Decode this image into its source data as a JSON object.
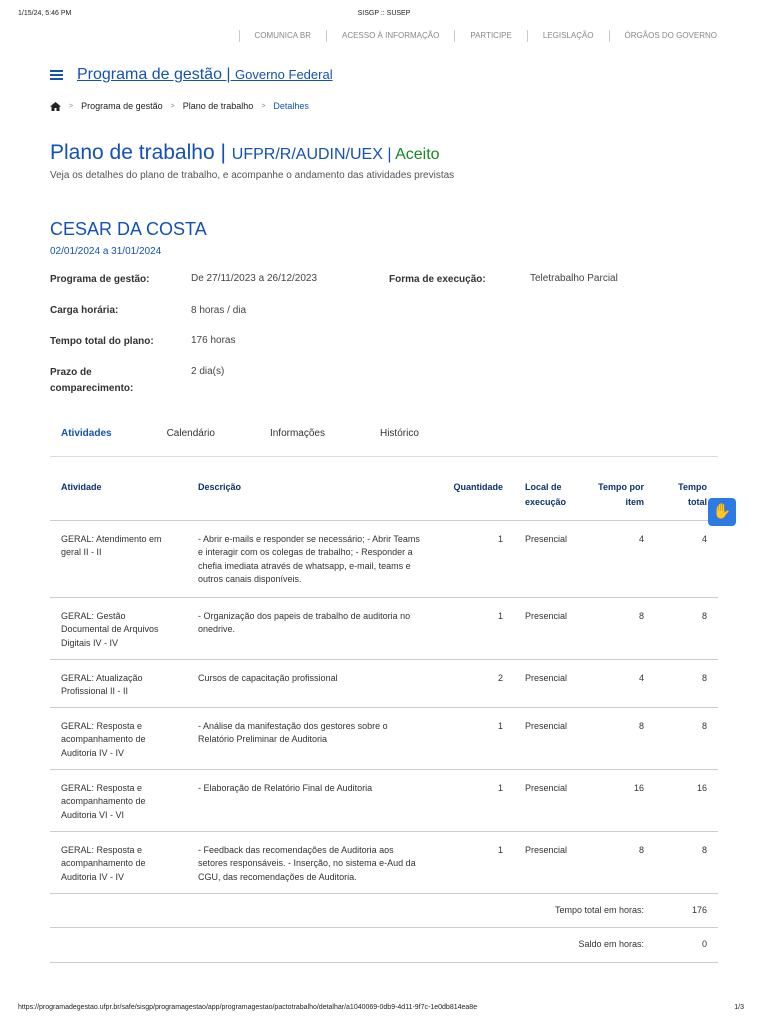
{
  "print": {
    "datetime": "1/15/24, 5:46 PM",
    "page_title": "SISGP :: SUSEP",
    "url": "https://programadegestao.ufpr.br/safe/sisgp/programagestao/app/programagestao/pactotrabalho/detalhar/a1040069-0db9-4d11-9f7c-1e0db814ea8e",
    "page": "1/3"
  },
  "govbar": [
    "COMUNICA BR",
    "ACESSO À INFORMAÇÃO",
    "PARTICIPE",
    "LEGISLAÇÃO",
    "ÓRGÃOS DO GOVERNO"
  ],
  "brand": {
    "title": "Programa de gestão | ",
    "sub": "Governo Federal"
  },
  "breadcrumb": [
    "Programa de gestão",
    "Plano de trabalho",
    "Detalhes"
  ],
  "header": {
    "title": "Plano de trabalho | ",
    "unit": "UFPR/R/AUDIN/UEX",
    "sep": " | ",
    "status": "Aceito",
    "description": "Veja os detalhes do plano de trabalho, e acompanhe o andamento das atividades previstas"
  },
  "person": {
    "name": "CESAR DA COSTA",
    "period": "02/01/2024 a 31/01/2024"
  },
  "details": {
    "programa_label": "Programa de gestão:",
    "programa": "De 27/11/2023 a 26/12/2023",
    "forma_label": "Forma de execução:",
    "forma": "Teletrabalho Parcial",
    "carga_label": "Carga horária:",
    "carga": "8 horas / dia",
    "tempo_label": "Tempo total do plano:",
    "tempo": "176 horas",
    "prazo_label": "Prazo de comparecimento:",
    "prazo": "2 dia(s)"
  },
  "tabs": [
    "Atividades",
    "Calendário",
    "Informações",
    "Histórico"
  ],
  "table": {
    "headers": [
      "Atividade",
      "Descrição",
      "Quantidade",
      "Local de execução",
      "Tempo por item",
      "Tempo total"
    ],
    "rows": [
      [
        "GERAL: Atendimento em geral II - II",
        "- Abrir e-mails e responder se necessário; - Abrir Teams e interagir com os colegas de trabalho; - Responder a chefia imediata através de whatsapp, e-mail, teams e outros canais disponíveis.",
        "1",
        "Presencial",
        "4",
        "4"
      ],
      [
        "GERAL: Gestão Documental de Arquivos Digitais IV - IV",
        "- Organização dos papeis de trabalho de auditoria no onedrive.",
        "1",
        "Presencial",
        "8",
        "8"
      ],
      [
        "GERAL: Atualização Profissional II - II",
        "Cursos de capacitação profissional",
        "2",
        "Presencial",
        "4",
        "8"
      ],
      [
        "GERAL: Resposta e acompanhamento de Auditoria IV - IV",
        "- Análise da manifestação dos gestores sobre o Relatório Preliminar de Auditoria",
        "1",
        "Presencial",
        "8",
        "8"
      ],
      [
        "GERAL: Resposta e acompanhamento de Auditoria VI - VI",
        "- Elaboração de Relatório Final de Auditoria",
        "1",
        "Presencial",
        "16",
        "16"
      ],
      [
        "GERAL: Resposta e acompanhamento de Auditoria IV - IV",
        "- Feedback das recomendações de Auditoria aos setores responsáveis. - Inserção, no sistema e-Aud da CGU, das recomendações de Auditoria.",
        "1",
        "Presencial",
        "8",
        "8"
      ]
    ],
    "total_label": "Tempo total em horas:",
    "total": "176",
    "saldo_label": "Saldo em horas:",
    "saldo": "0"
  }
}
